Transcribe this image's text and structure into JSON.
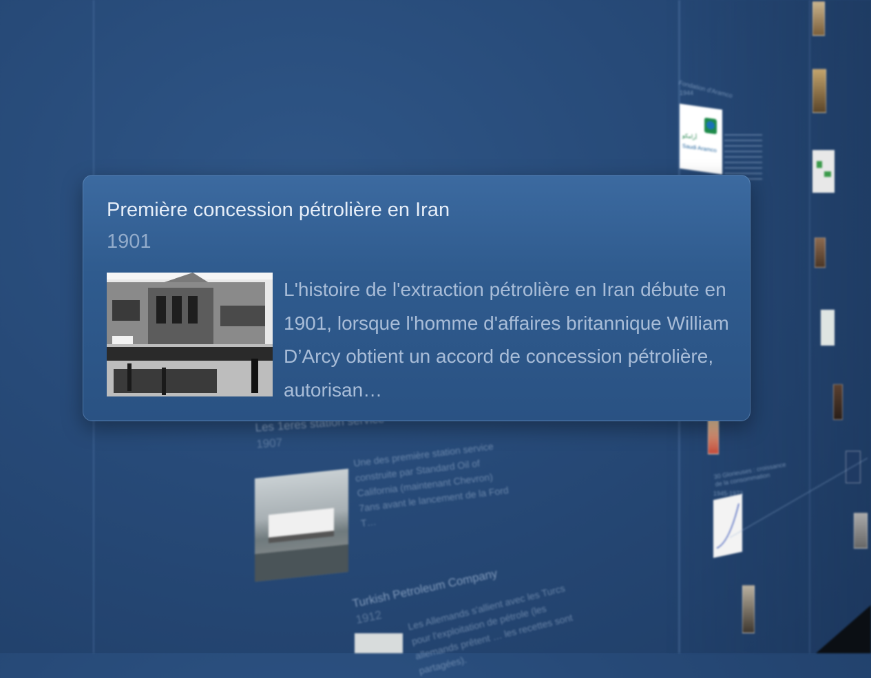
{
  "popup": {
    "title": "Première concession pétrolière en Iran",
    "year": "1901",
    "description": "L'histoire de l'extraction pétrolière en Iran débute en 1901, lorsque l'homme d'affaires britannique William D’Arcy obtient un accord de concession pétrolière, autorisan…"
  },
  "background_events": [
    {
      "title": "Les 1eres station service",
      "year": "1907",
      "description": "Une des première station service construite par Standard Oil of California (maintenant Chevron) 7ans avant le lancement de la Ford T…"
    },
    {
      "title": "Turkish Petroleum Company",
      "year": "1912",
      "description": "Les Allemands s'allient avec les Turcs pour l'exploitation de pétrole (les allemands prêtent … les recettes sont partagées)."
    }
  ],
  "side_events": [
    {
      "title": "Fondation d'Aramco",
      "year": "1944",
      "logo_text": "أرامكو السعودية Saudi Aramco"
    },
    {
      "title": "30 Glorieuses : croissance de la consommation",
      "year": "1945-1973"
    }
  ],
  "colors": {
    "background": "#274a78",
    "popup": "#2f5b8e",
    "title_text": "#e6eef8",
    "year_text": "#93accb",
    "description_text": "#a9bdd8"
  }
}
